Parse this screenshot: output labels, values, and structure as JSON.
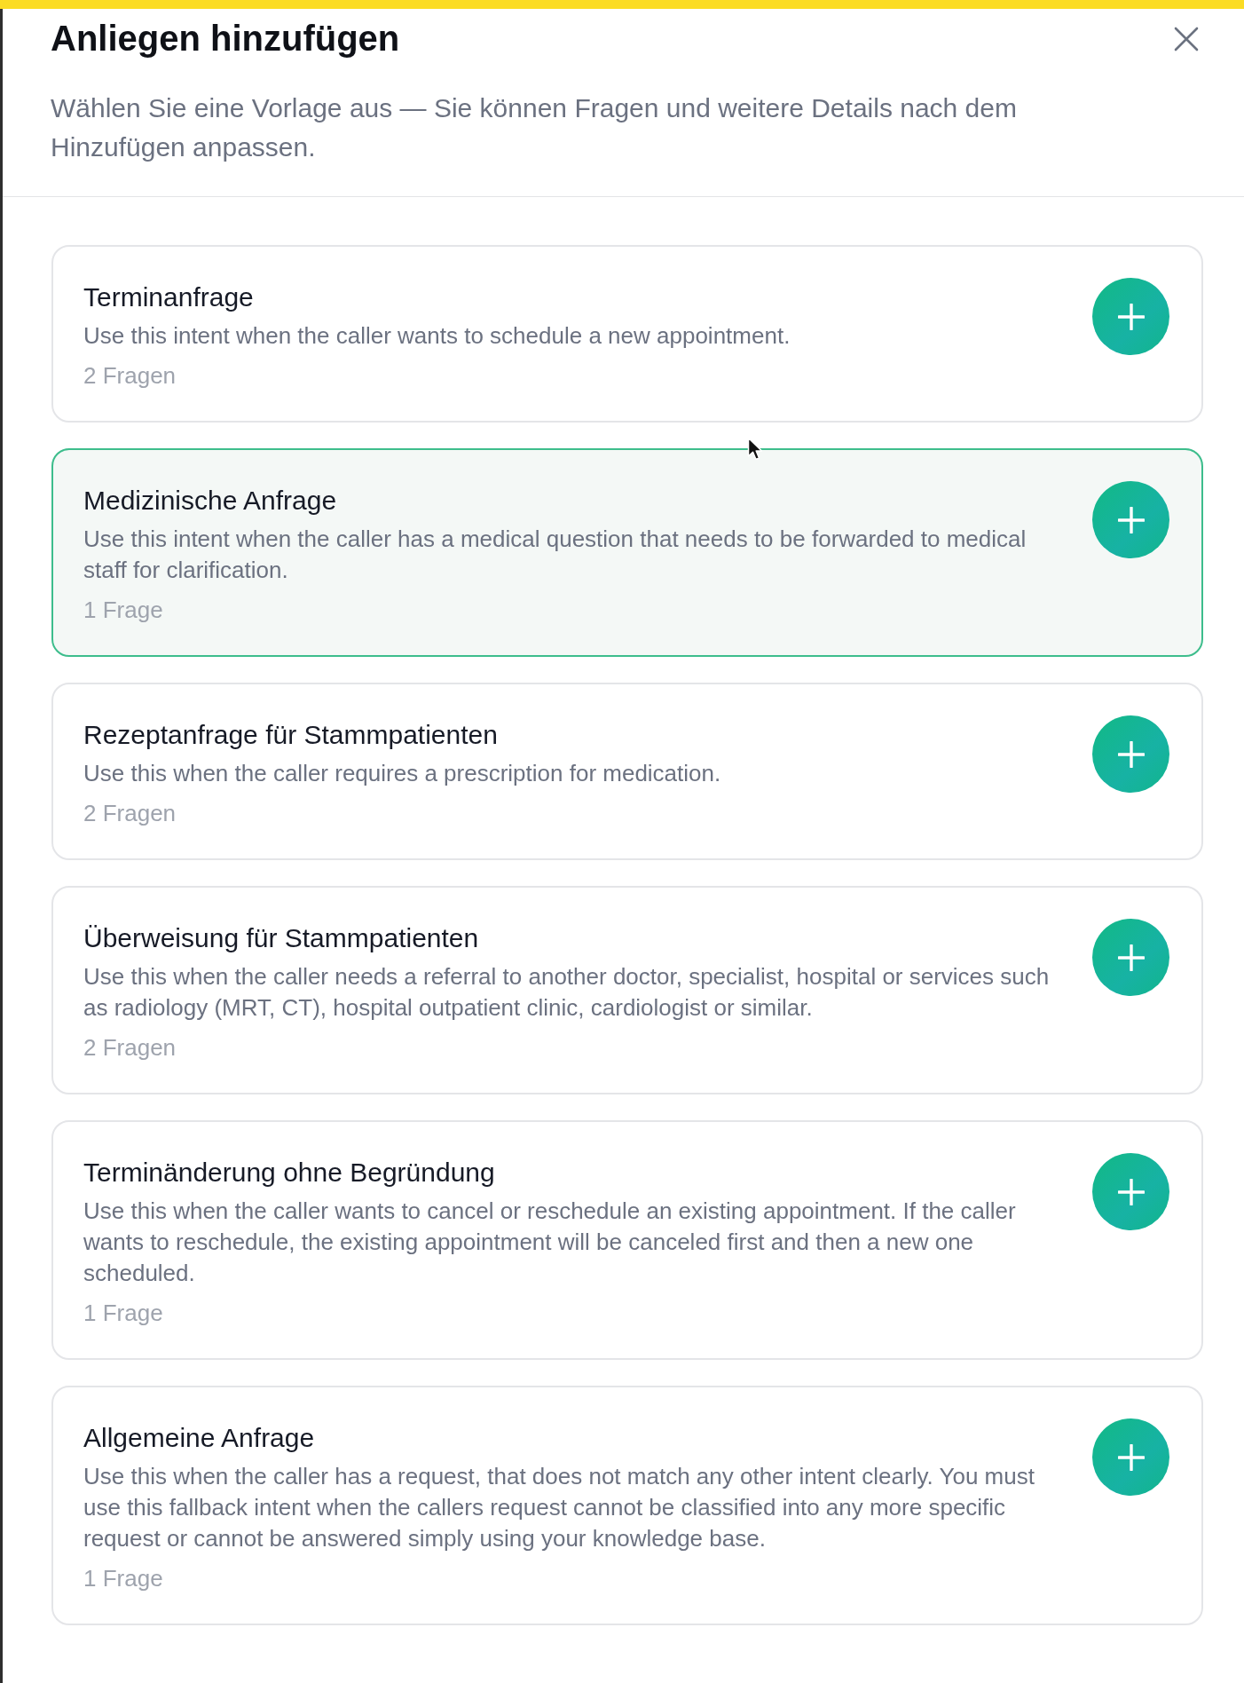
{
  "dialog": {
    "title": "Anliegen hinzufügen",
    "subtitle": "Wählen Sie eine Vorlage aus — Sie können Fragen und weitere Details nach dem Hinzufügen anpassen."
  },
  "templates": [
    {
      "title": "Terminanfrage",
      "description": "Use this intent when the caller wants to schedule a new appointment.",
      "question_count": "2 Fragen",
      "selected": false
    },
    {
      "title": "Medizinische Anfrage",
      "description": "Use this intent when the caller has a medical question that needs to be forwarded to medical staff for clarification.",
      "question_count": "1 Frage",
      "selected": true
    },
    {
      "title": "Rezeptanfrage für Stammpatienten",
      "description": "Use this when the caller requires a prescription for medication.",
      "question_count": "2 Fragen",
      "selected": false
    },
    {
      "title": "Überweisung für Stammpatienten",
      "description": "Use this when the caller needs a referral to another doctor, specialist, hospital or services such as radiology (MRT, CT), hospital outpatient clinic, cardiologist or similar.",
      "question_count": "2 Fragen",
      "selected": false
    },
    {
      "title": "Terminänderung ohne Begründung",
      "description": "Use this when the caller wants to cancel or reschedule an existing appointment. If the caller wants to reschedule, the existing appointment will be canceled first and then a new one scheduled.",
      "question_count": "1 Frage",
      "selected": false
    },
    {
      "title": "Allgemeine Anfrage",
      "description": "Use this when the caller has a request, that does not match any other intent clearly. You must use this fallback intent when the callers request cannot be classified into any more specific request or cannot be answered simply using your knowledge base.",
      "question_count": "1 Frage",
      "selected": false
    }
  ]
}
